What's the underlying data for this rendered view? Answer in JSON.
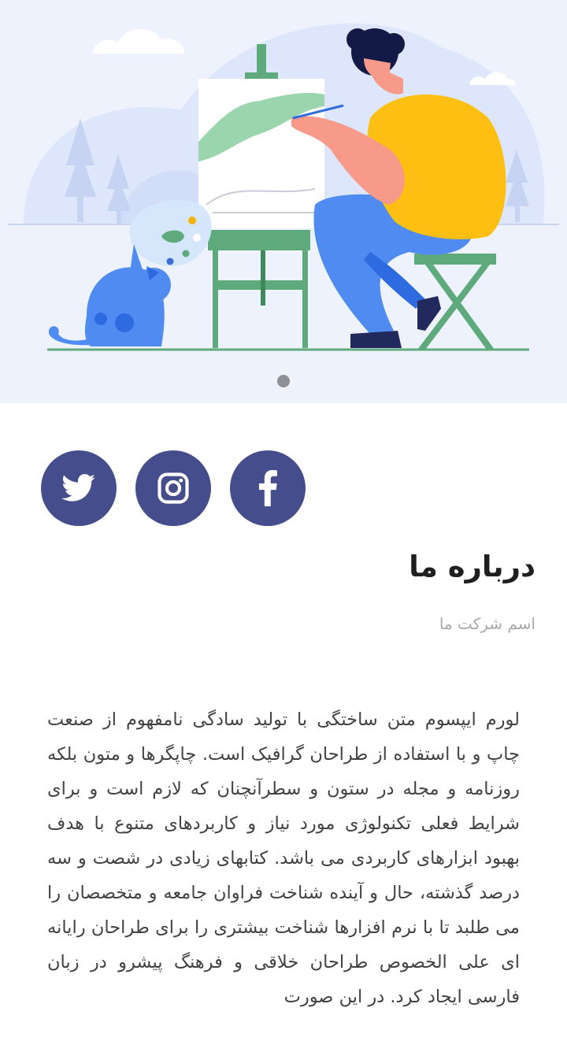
{
  "hero": {
    "illustration": "painter-at-easel-with-cat",
    "carousel_dots": 1,
    "active_dot": 0
  },
  "social": [
    {
      "icon": "twitter-icon",
      "label": "Twitter"
    },
    {
      "icon": "instagram-icon",
      "label": "Instagram"
    },
    {
      "icon": "facebook-icon",
      "label": "Facebook"
    }
  ],
  "about": {
    "title": "درباره ما",
    "company_name": "اسم شرکت ما",
    "body": "لورم ایپسوم متن ساختگی با تولید سادگی نامفهوم از صنعت چاپ و با استفاده از طراحان گرافیک است. چاپگرها و متون بلکه روزنامه و مجله در ستون و سطرآنچنان که لازم است و برای شرایط فعلی تکنولوژی مورد نیاز و کاربردهای متنوع با هدف بهبود ابزارهای کاربردی می باشد. کتابهای زیادی در شصت و سه درصد گذشته، حال و آینده شناخت فراوان جامعه و متخصصان را می طلبد تا با نرم افزارها شناخت بیشتری را برای طراحان رایانه ای علی الخصوص طراحان خلاقی و فرهنگ پیشرو در زبان فارسی ایجاد کرد. در این صورت"
  },
  "colors": {
    "hero_bg": "#edf2fd",
    "social_bg": "#454d8d",
    "title": "#1f1f1f",
    "subtitle": "#a9a9a9",
    "body": "#424242"
  }
}
